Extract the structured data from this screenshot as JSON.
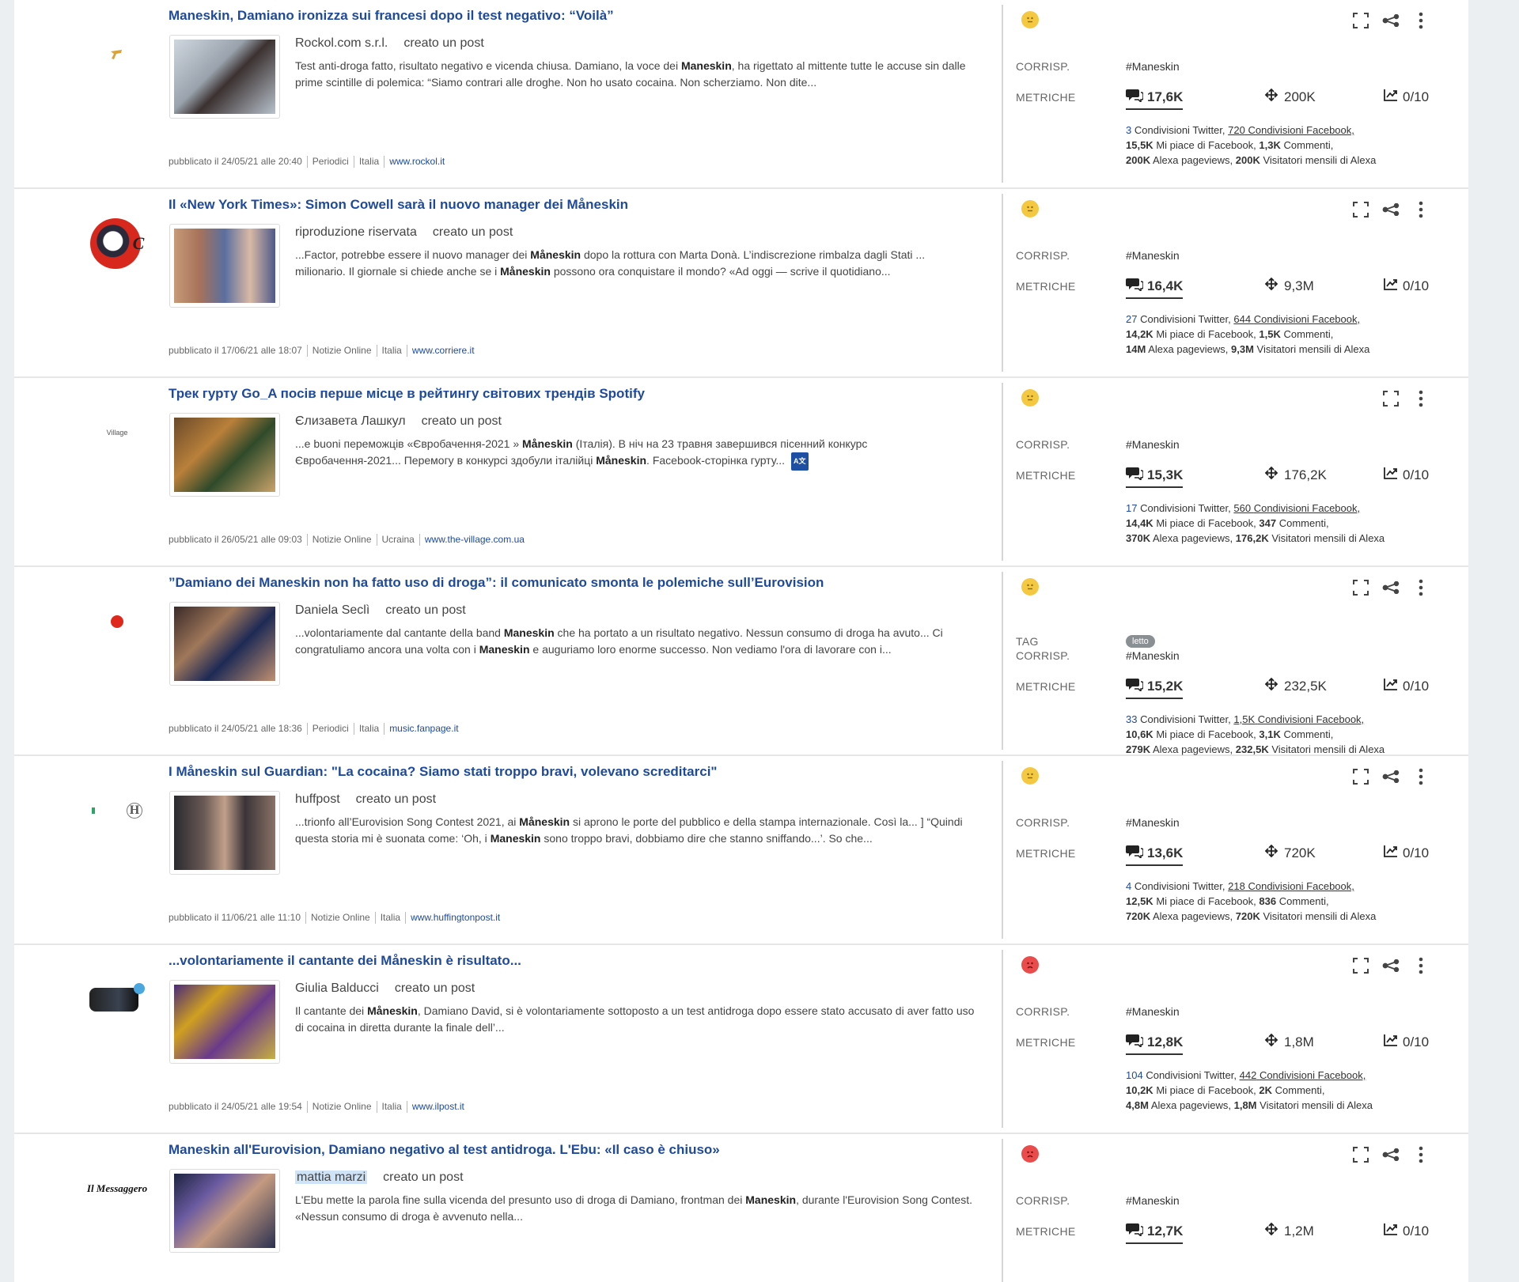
{
  "labels": {
    "match": "CORRISP.",
    "metrics": "METRICHE",
    "tag": "TAG",
    "created_post": "creato un post",
    "twitter_shares": "Condivisioni Twitter,",
    "facebook_shares": "Condivisioni Facebook,",
    "fb_likes": "Mi piace di Facebook,",
    "comments": "Commenti,",
    "alexa_pageviews": "Alexa pageviews,",
    "alexa_visitors": "Visitatori mensili di Alexa"
  },
  "colors": {
    "link": "#1f4a9c",
    "neutral_sentiment": "#f5c842",
    "negative_sentiment": "#ea4b4b"
  },
  "articles": [
    {
      "title": "Maneskin, Damiano ironizza sui francesi dopo il test negativo: “Voilà”",
      "author": "Rockol.com s.r.l.",
      "snippet_html": "Test anti-droga fatto, risultato negativo e vicenda chiusa. Damiano, la voce dei <b>Maneskin</b>, ha rigettato al mittente tutte le accuse sin dalle prime scintille di polemica: “Siamo contrari alle droghe. Non ho usato cocaina. Non scherziamo. Non dite...",
      "published": "pubblicato il 24/05/21 alle 20:40",
      "category": "Periodici",
      "country": "Italia",
      "url": "www.rockol.it",
      "sentiment": "neutral",
      "tag": "",
      "match": "#Maneskin",
      "comments": "17,6K",
      "reach": "200K",
      "score": "0/10",
      "twitter": "3",
      "facebook": "720",
      "likes": "15,5K",
      "fb_comments": "1,3K",
      "pageviews": "200K",
      "visitors": "200K",
      "share_icon": true
    },
    {
      "title": "Il «New York Times»: Simon Cowell sarà il nuovo manager dei Måneskin",
      "author": "riproduzione riservata",
      "snippet_html": "...Factor, potrebbe essere il nuovo manager dei <b>Måneskin</b> dopo la rottura con Marta Donà. L’indiscrezione rimbalza dagli Stati ... milionario. Il giornale si chiede anche se i <b>Måneskin</b> possono ora conquistare il mondo? «Ad oggi — scrive il quotidiano...",
      "published": "pubblicato il 17/06/21 alle 18:07",
      "category": "Notizie Online",
      "country": "Italia",
      "url": "www.corriere.it",
      "sentiment": "neutral",
      "tag": "",
      "match": "#Maneskin",
      "comments": "16,4K",
      "reach": "9,3M",
      "score": "0/10",
      "twitter": "27",
      "facebook": "644",
      "likes": "14,2K",
      "fb_comments": "1,5K",
      "pageviews": "14M",
      "visitors": "9,3M",
      "share_icon": true
    },
    {
      "title": "Трек гурту Go_A посів перше місце в рейтингу світових трендів Spotify",
      "author": "Єлизавета Лашкул",
      "snippet_html": "...e buoni переможців «Євробачення-2021 » <b>Måneskin</b> (Італія). В ніч на 23 травня завершився пісенний конкурс Євробачення-2021... Перемогу в конкурсі здобули італійці <b>Måneskin</b>. Facebook-сторінка гурту...",
      "translate_badge": "A文",
      "published": "pubblicato il 26/05/21 alle 09:03",
      "category": "Notizie Online",
      "country": "Ucraina",
      "url": "www.the-village.com.ua",
      "sentiment": "neutral",
      "tag": "",
      "match": "#Maneskin",
      "comments": "15,3K",
      "reach": "176,2K",
      "score": "0/10",
      "twitter": "17",
      "facebook": "560",
      "likes": "14,4K",
      "fb_comments": "347",
      "pageviews": "370K",
      "visitors": "176,2K",
      "share_icon": false
    },
    {
      "title": "”Damiano dei Maneskin non ha fatto uso di droga”: il comunicato smonta le polemiche sull’Eurovision",
      "author": "Daniela Seclì",
      "snippet_html": "...volontariamente dal cantante della band <b>Maneskin</b> che ha portato a un risultato negativo. Nessun consumo di droga ha avuto... Ci congratuliamo ancora una volta con i <b>Maneskin</b> e auguriamo loro enorme successo. Non vediamo l'ora di lavorare con i...",
      "published": "pubblicato il 24/05/21 alle 18:36",
      "category": "Periodici",
      "country": "Italia",
      "url": "music.fanpage.it",
      "sentiment": "neutral",
      "tag": "letto",
      "match": "#Maneskin",
      "comments": "15,2K",
      "reach": "232,5K",
      "score": "0/10",
      "twitter": "33",
      "facebook": "1,5K",
      "likes": "10,6K",
      "fb_comments": "3,1K",
      "pageviews": "279K",
      "visitors": "232,5K",
      "share_icon": true
    },
    {
      "title": "I Måneskin sul Guardian: \"La cocaina? Siamo stati troppo bravi, volevano screditarci\"",
      "author": "huffpost",
      "snippet_html": "...trionfo all’Eurovision Song Contest 2021, ai <b>Måneskin</b> si aprono le porte del pubblico e della stampa internazionale. Così la... ] “Quindi questa storia mi è suonata come: ‘Oh, i <b>Maneskin</b> sono troppo bravi, dobbiamo dire che stanno sniffando...’. So che...",
      "published": "pubblicato il 11/06/21 alle 11:10",
      "category": "Notizie Online",
      "country": "Italia",
      "url": "www.huffingtonpost.it",
      "sentiment": "neutral",
      "tag": "",
      "match": "#Maneskin",
      "comments": "13,6K",
      "reach": "720K",
      "score": "0/10",
      "twitter": "4",
      "facebook": "218",
      "likes": "12,5K",
      "fb_comments": "836",
      "pageviews": "720K",
      "visitors": "720K",
      "share_icon": true
    },
    {
      "title": "...volontariamente il cantante dei Måneskin è risultato...",
      "author": "Giulia Balducci",
      "snippet_html": "Il cantante dei <b>Måneskin</b>, Damiano David, si è volontariamente sottoposto a un test antidroga dopo essere stato accusato di aver fatto uso di cocaina in diretta durante la finale dell’...",
      "published": "pubblicato il 24/05/21 alle 19:54",
      "category": "Notizie Online",
      "country": "Italia",
      "url": "www.ilpost.it",
      "sentiment": "negative",
      "tag": "",
      "match": "#Maneskin",
      "comments": "12,8K",
      "reach": "1,8M",
      "score": "0/10",
      "twitter": "104",
      "facebook": "442",
      "likes": "10,2K",
      "fb_comments": "2K",
      "pageviews": "4,8M",
      "visitors": "1,8M",
      "share_icon": true
    },
    {
      "title": "Maneskin all'Eurovision, Damiano negativo al test antidroga. L'Ebu: «Il caso è chiuso»",
      "author": "mattia marzi",
      "author_highlight": true,
      "snippet_html": "L'Ebu mette la parola fine sulla vicenda del presunto uso di droga di Damiano, frontman dei <b>Maneskin</b>, durante l'Eurovision Song Contest. «Nessun consumo di droga è avvenuto nella...",
      "logo_text": "Il Messaggero",
      "published": "",
      "category": "",
      "country": "",
      "url": "",
      "sentiment": "negative",
      "tag": "",
      "match": "#Maneskin",
      "comments": "12,7K",
      "reach": "1,2M",
      "score": "0/10",
      "twitter": "",
      "facebook": "",
      "likes": "",
      "fb_comments": "",
      "pageviews": "",
      "visitors": "",
      "share_icon": true
    }
  ]
}
